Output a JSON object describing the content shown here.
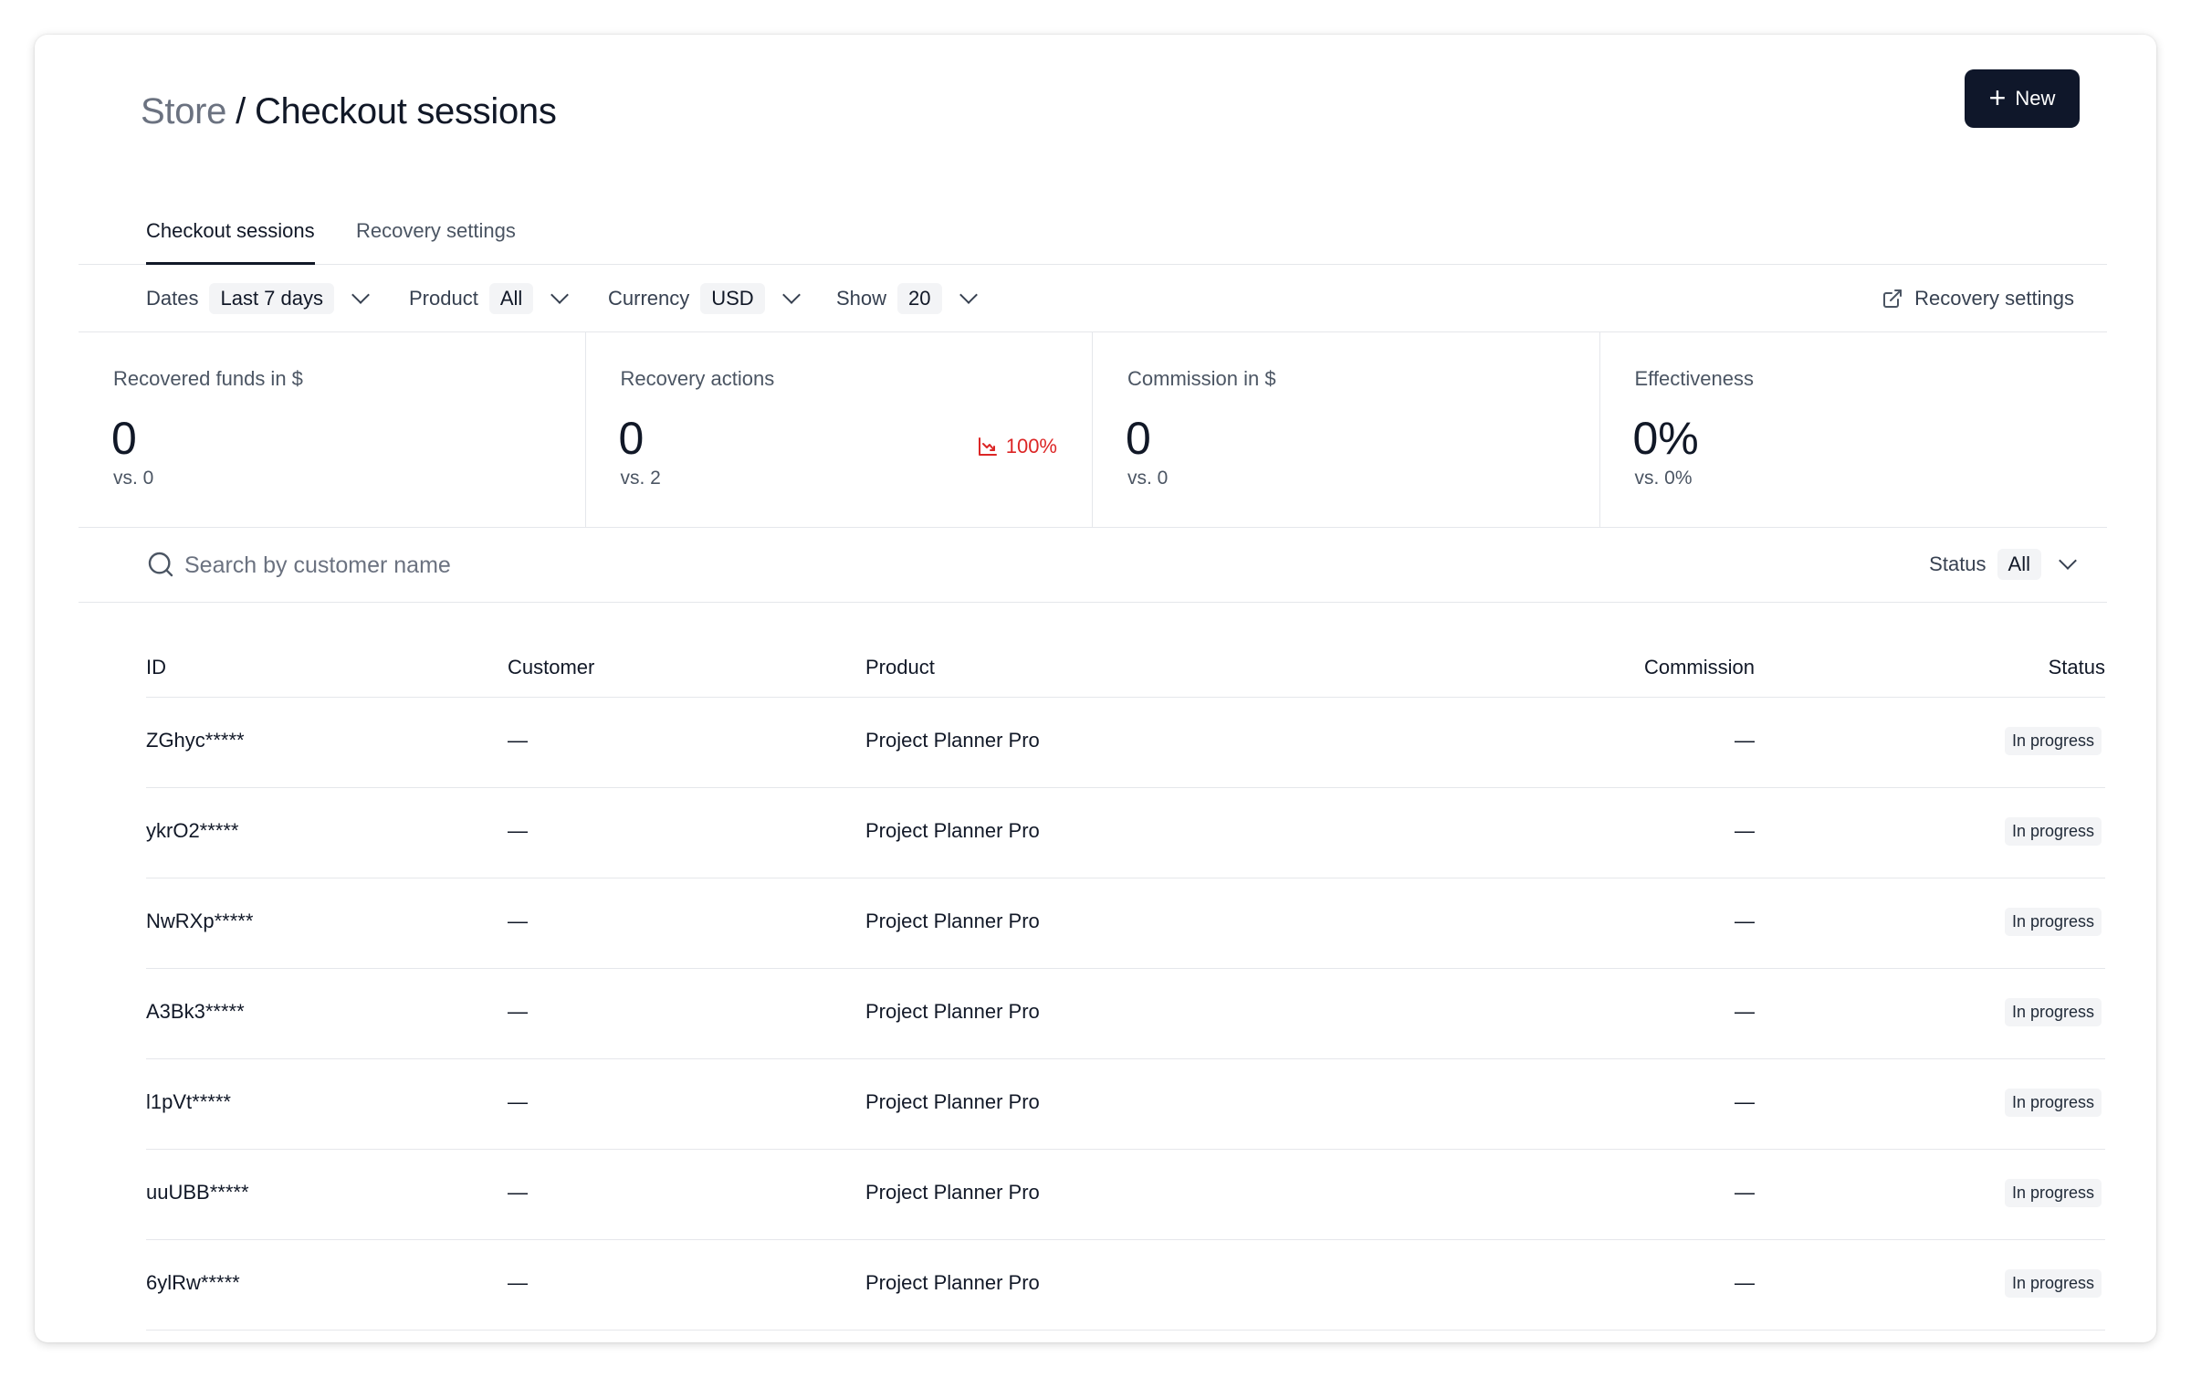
{
  "header": {
    "breadcrumb_parent": "Store",
    "separator": "/",
    "page_title": "Checkout sessions",
    "new_button": "New"
  },
  "tabs": [
    {
      "label": "Checkout sessions",
      "active": true
    },
    {
      "label": "Recovery settings",
      "active": false
    }
  ],
  "filters": {
    "dates": {
      "label": "Dates",
      "value": "Last 7 days"
    },
    "product": {
      "label": "Product",
      "value": "All"
    },
    "currency": {
      "label": "Currency",
      "value": "USD"
    },
    "show": {
      "label": "Show",
      "value": "20"
    },
    "recovery_link": "Recovery settings"
  },
  "stats": [
    {
      "label": "Recovered funds in $",
      "value": "0",
      "compare": "vs. 0"
    },
    {
      "label": "Recovery actions",
      "value": "0",
      "compare": "vs. 2",
      "trend": "100%",
      "trend_direction": "down",
      "trend_color": "#dc2626"
    },
    {
      "label": "Commission in $",
      "value": "0",
      "compare": "vs. 0"
    },
    {
      "label": "Effectiveness",
      "value": "0%",
      "compare": "vs. 0%"
    }
  ],
  "search": {
    "placeholder": "Search by customer name",
    "status_label": "Status",
    "status_value": "All"
  },
  "table": {
    "columns": [
      "ID",
      "Customer",
      "Product",
      "Commission",
      "Status"
    ],
    "rows": [
      {
        "id": "ZGhyc*****",
        "customer": "—",
        "product": "Project Planner Pro",
        "commission": "—",
        "status": "In progress"
      },
      {
        "id": "ykrO2*****",
        "customer": "—",
        "product": "Project Planner Pro",
        "commission": "—",
        "status": "In progress"
      },
      {
        "id": "NwRXp*****",
        "customer": "—",
        "product": "Project Planner Pro",
        "commission": "—",
        "status": "In progress"
      },
      {
        "id": "A3Bk3*****",
        "customer": "—",
        "product": "Project Planner Pro",
        "commission": "—",
        "status": "In progress"
      },
      {
        "id": "l1pVt*****",
        "customer": "—",
        "product": "Project Planner Pro",
        "commission": "—",
        "status": "In progress"
      },
      {
        "id": "uuUBB*****",
        "customer": "—",
        "product": "Project Planner Pro",
        "commission": "—",
        "status": "In progress"
      },
      {
        "id": "6ylRw*****",
        "customer": "—",
        "product": "Project Planner Pro",
        "commission": "—",
        "status": "In progress"
      }
    ]
  },
  "colors": {
    "primary_button": "#0f172a",
    "negative_trend": "#dc2626"
  }
}
